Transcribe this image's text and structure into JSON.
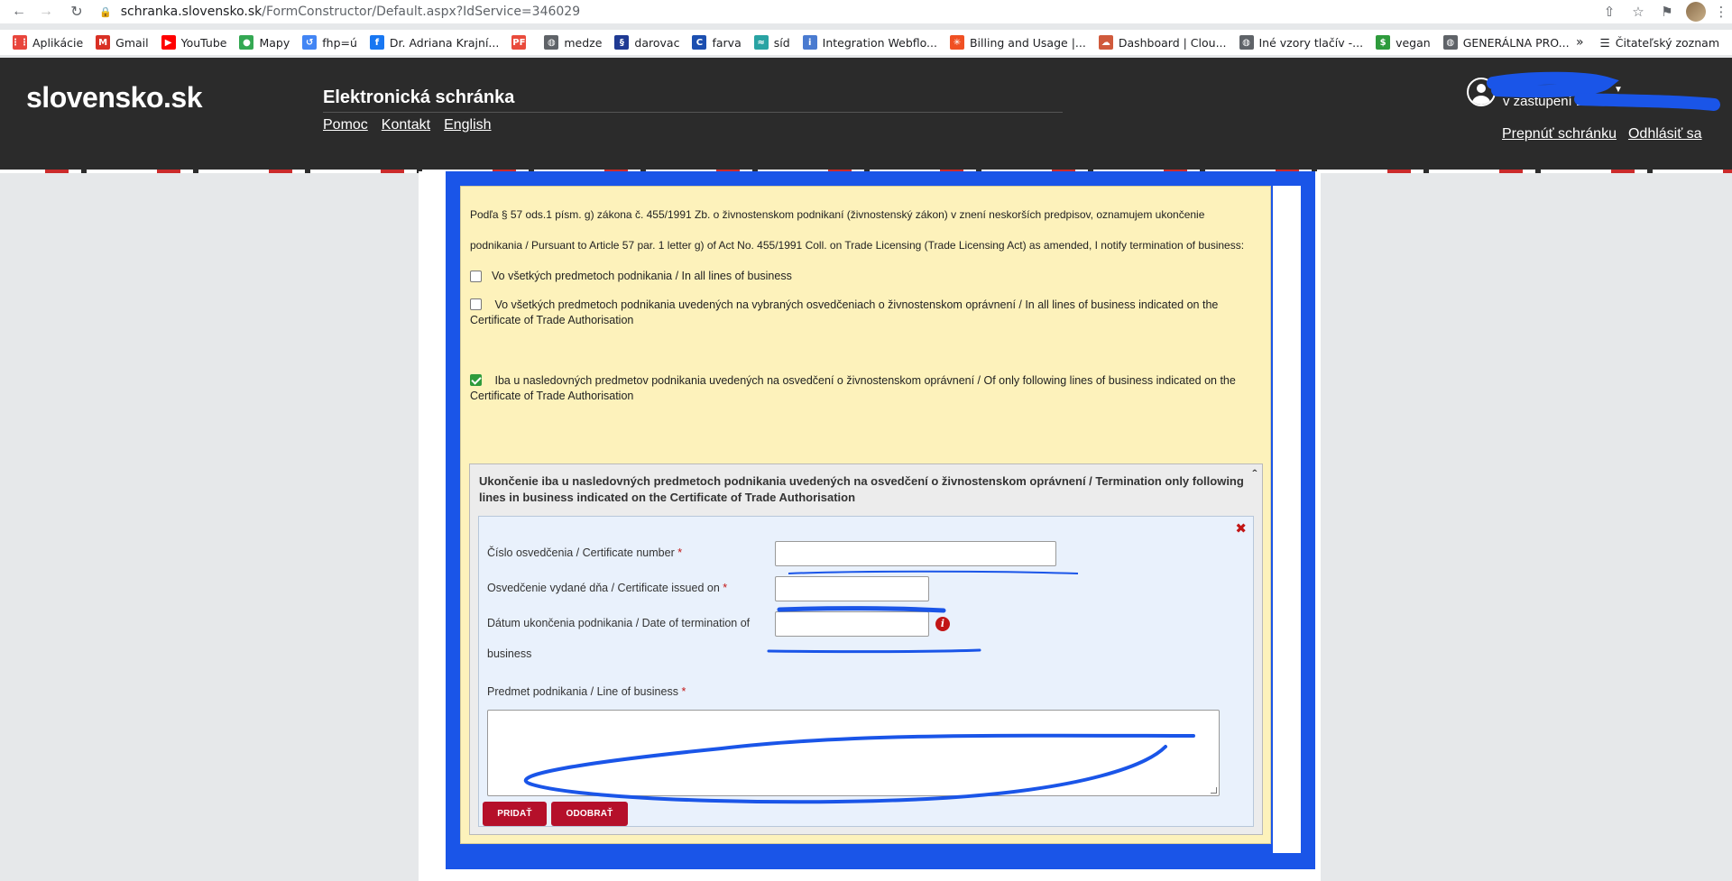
{
  "browser": {
    "url_host": "schranka.slovensko.sk",
    "url_path": "/FormConstructor/Default.aspx?IdService=346029",
    "bookmarks": [
      {
        "label": "Aplikácie",
        "icon": "apps-grid-icon",
        "color": "#e8453c"
      },
      {
        "label": "Gmail",
        "icon": "gmail-icon",
        "color": "#d93025"
      },
      {
        "label": "YouTube",
        "icon": "youtube-icon",
        "color": "#ff0000"
      },
      {
        "label": "Mapy",
        "icon": "maps-pin-icon",
        "color": "#34a853"
      },
      {
        "label": "fhp=ú",
        "icon": "history-icon",
        "color": "#4285f4"
      },
      {
        "label": "Dr. Adriana Krajní...",
        "icon": "facebook-icon",
        "color": "#1877f2"
      },
      {
        "label": "",
        "icon": "pf-icon",
        "color": "#e94b3c"
      },
      {
        "label": "medze",
        "icon": "globe-icon",
        "color": "#5f6368"
      },
      {
        "label": "darovac",
        "icon": "section-sign-icon",
        "color": "#1f3a93"
      },
      {
        "label": "farva",
        "icon": "c-icon",
        "color": "#1c4fb0"
      },
      {
        "label": "síd",
        "icon": "wave-icon",
        "color": "#29a3a3"
      },
      {
        "label": "Integration Webflo...",
        "icon": "info-circle-icon",
        "color": "#4a7bd0"
      },
      {
        "label": "Billing and Usage |...",
        "icon": "asterisk-icon",
        "color": "#f05023"
      },
      {
        "label": "Dashboard | Clou...",
        "icon": "cloud-icon",
        "color": "#d05a3c"
      },
      {
        "label": "Iné vzory tlačív -...",
        "icon": "globe-icon",
        "color": "#5f6368"
      },
      {
        "label": "vegan",
        "icon": "dollar-icon",
        "color": "#2e9b3c"
      },
      {
        "label": "GENERÁLNA PRO...",
        "icon": "globe-icon",
        "color": "#5f6368"
      }
    ],
    "more_label": "»",
    "reading_list": "Čitateľský zoznam"
  },
  "header": {
    "logo": "slovensko.sk",
    "title": "Elektronická schránka",
    "links": [
      "Pomoc",
      "Kontakt",
      "English"
    ],
    "user_line2": "v zastúpení D",
    "switch_box": "Prepnúť schránku",
    "logout": "Odhlásiť sa"
  },
  "form": {
    "intro": "Podľa § 57 ods.1 písm. g) zákona č. 455/1991 Zb. o živnostenskom podnikaní (živnostenský zákon) v znení neskorších predpisov, oznamujem ukončenie podnikania / Pursuant to Article 57 par. 1 letter g) of Act No. 455/1991 Coll. on Trade Licensing (Trade Licensing Act) as amended, I notify termination of business:",
    "options": [
      {
        "label": "Vo všetkých predmetoch podnikania / In all lines of business",
        "checked": false
      },
      {
        "label": "Vo všetkých predmetoch podnikania uvedených na vybraných osvedčeniach o živnostenskom oprávnení / In all lines of business indicated on the Certificate of Trade Authorisation",
        "checked": false
      },
      {
        "label": "Iba u nasledovných predmetov podnikania uvedených na osvedčení o živnostenskom oprávnení / Of only following lines of business indicated on the Certificate of Trade Authorisation",
        "checked": true
      }
    ],
    "section_title": "Ukončenie iba u nasledovných predmetoch podnikania uvedených na osvedčení o živnostenskom oprávnení / Termination only following lines in business indicated on the Certificate of Trade Authorisation",
    "fields": {
      "certificate_number": {
        "label": "Číslo osvedčenia / Certificate number",
        "value": ""
      },
      "issued_on": {
        "label": "Osvedčenie vydané dňa / Certificate issued on",
        "value": ""
      },
      "termination_date": {
        "label": "Dátum ukončenia podnikania / Date of termination of business",
        "value": ""
      },
      "line_of_business": {
        "label": "Predmet podnikania / Line of business",
        "value": ""
      }
    },
    "required_mark": "*",
    "remove_mark": "✖",
    "info_mark": "i",
    "add_button": "PRIDAŤ",
    "remove_button": "ODOBRAŤ"
  },
  "colors": {
    "header_bg": "#2b2b2b",
    "frame_blue": "#1a55e8",
    "panel_yellow": "#fdf2bb",
    "button_red": "#b5102a",
    "check_green": "#2e9b3c"
  }
}
